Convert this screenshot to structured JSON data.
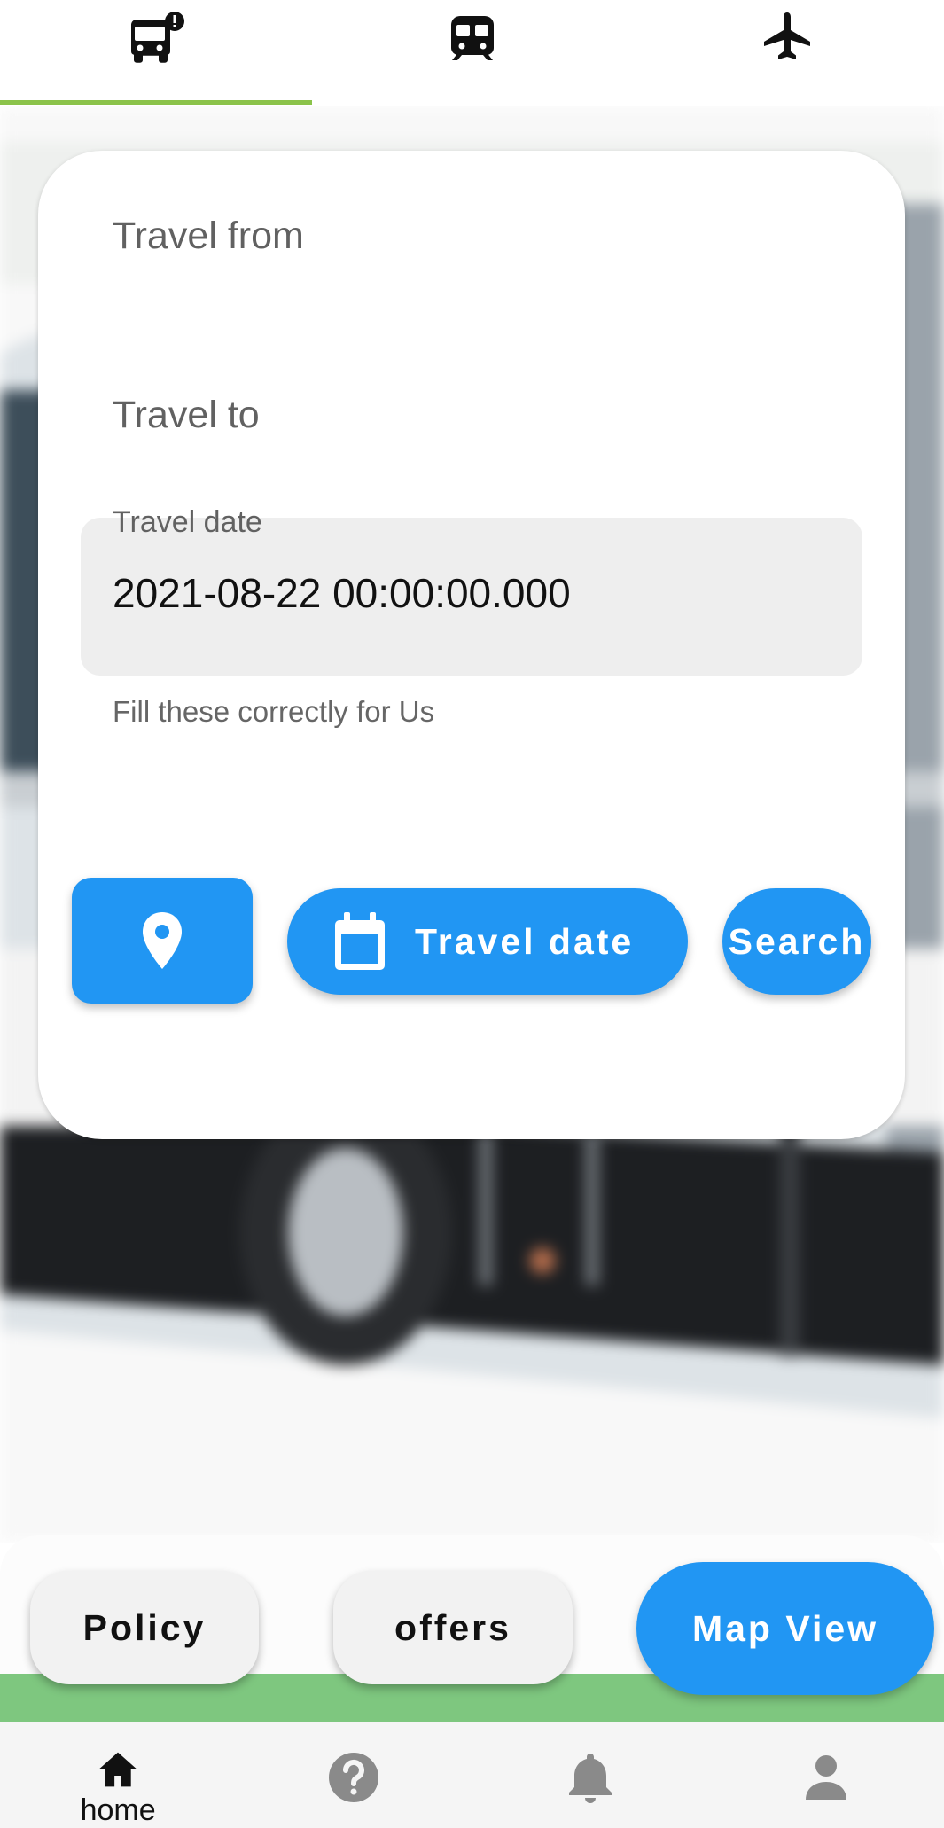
{
  "top_tabs": [
    {
      "icon": "bus-alert-icon",
      "selected": true
    },
    {
      "icon": "train-icon",
      "selected": false
    },
    {
      "icon": "airplane-icon",
      "selected": false
    }
  ],
  "form": {
    "from_label": "Travel from",
    "to_label": "Travel to",
    "date_label": "Travel date",
    "date_value": "2021-08-22 00:00:00.000",
    "helper": "Fill these correctly for Us"
  },
  "actions": {
    "location_icon": "location-pin-icon",
    "date_button": "Travel date",
    "date_icon": "calendar-icon",
    "search_button": "Search"
  },
  "quick_actions": {
    "policy": "Policy",
    "offers": "offers",
    "map_view": "Map View"
  },
  "bottom_nav": [
    {
      "label": "home",
      "icon": "home-icon",
      "selected": true
    },
    {
      "label": "",
      "icon": "help-icon",
      "selected": false
    },
    {
      "label": "",
      "icon": "bell-icon",
      "selected": false
    },
    {
      "label": "",
      "icon": "person-icon",
      "selected": false
    }
  ],
  "colors": {
    "primary": "#2196f3",
    "tab_indicator": "#8bc34a",
    "green_strip": "#7ec77f"
  }
}
